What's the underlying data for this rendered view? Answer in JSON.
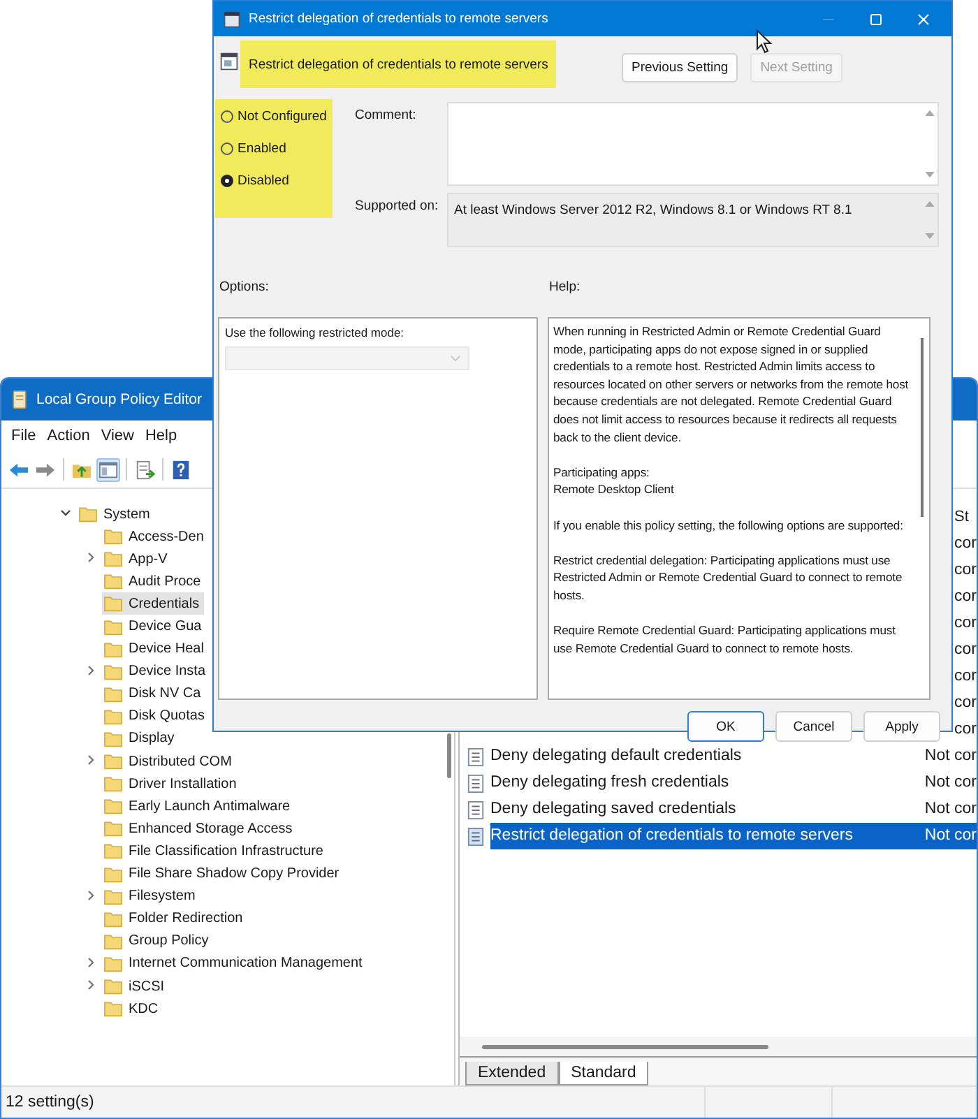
{
  "main_window": {
    "title": "Local Group Policy Editor",
    "menu": [
      "File",
      "Action",
      "View",
      "Help"
    ],
    "tree": [
      {
        "label": "System",
        "expanded": true,
        "selected": false,
        "children": [
          {
            "label": "Access-Den",
            "selected": false
          },
          {
            "label": "App-V",
            "expanded": false,
            "selected": false
          },
          {
            "label": "Audit Proce",
            "selected": false
          },
          {
            "label": "Credentials",
            "selected": true
          },
          {
            "label": "Device Gua",
            "selected": false
          },
          {
            "label": "Device Heal",
            "selected": false
          },
          {
            "label": "Device Insta",
            "expanded": false,
            "selected": false
          },
          {
            "label": "Disk NV Ca",
            "selected": false
          },
          {
            "label": "Disk Quotas",
            "selected": false
          },
          {
            "label": "Display",
            "selected": false
          },
          {
            "label": "Distributed COM",
            "expanded": false,
            "selected": false
          },
          {
            "label": "Driver Installation",
            "selected": false
          },
          {
            "label": "Early Launch Antimalware",
            "selected": false
          },
          {
            "label": "Enhanced Storage Access",
            "selected": false
          },
          {
            "label": "File Classification Infrastructure",
            "selected": false
          },
          {
            "label": "File Share Shadow Copy Provider",
            "selected": false
          },
          {
            "label": "Filesystem",
            "expanded": false,
            "selected": false
          },
          {
            "label": "Folder Redirection",
            "selected": false
          },
          {
            "label": "Group Policy",
            "selected": false
          },
          {
            "label": "Internet Communication Management",
            "expanded": false,
            "selected": false
          },
          {
            "label": "iSCSI",
            "expanded": false,
            "selected": false
          },
          {
            "label": "KDC",
            "selected": false
          }
        ]
      }
    ],
    "list": {
      "status_heading": "St",
      "rows": [
        {
          "status": "cor",
          "selected": false
        },
        {
          "status": "cor",
          "selected": false
        },
        {
          "status": "cor",
          "selected": false
        },
        {
          "status": "cor",
          "selected": false
        },
        {
          "status": "cor",
          "selected": false
        },
        {
          "status": "cor",
          "selected": false
        },
        {
          "status": "cor",
          "selected": false
        },
        {
          "status": "cor",
          "selected": false
        },
        {
          "name": "Deny delegating default credentials",
          "status": "Not cor",
          "selected": false
        },
        {
          "name": "Deny delegating fresh credentials",
          "status": "Not cor",
          "selected": false
        },
        {
          "name": "Deny delegating saved credentials",
          "status": "Not cor",
          "selected": false
        },
        {
          "name": "Restrict delegation of credentials to remote servers",
          "status": "Not cor",
          "selected": true
        }
      ]
    },
    "view_tabs": [
      {
        "label": "Extended",
        "selected": false
      },
      {
        "label": "Standard",
        "selected": true
      }
    ],
    "status_bar": "12 setting(s)"
  },
  "dialog": {
    "title": "Restrict delegation of credentials to remote servers",
    "policy_title": "Restrict delegation of credentials to remote servers",
    "policy_title_highlighted": true,
    "nav_buttons": [
      {
        "label": "Previous Setting",
        "disabled": false
      },
      {
        "label": "Next Setting",
        "disabled": true
      }
    ],
    "state_options": {
      "highlighted": true,
      "items": [
        {
          "label": "Not Configured",
          "selected": false
        },
        {
          "label": "Enabled",
          "selected": false
        },
        {
          "label": "Disabled",
          "selected": true
        }
      ]
    },
    "comment_label": "Comment:",
    "supported_label": "Supported on:",
    "supported_text": "At least Windows Server 2012 R2, Windows 8.1 or Windows RT 8.1",
    "options_label": "Options:",
    "help_label": "Help:",
    "options": {
      "label": "Use the following restricted mode:",
      "dropdown": {
        "disabled": true
      }
    },
    "help_paragraphs": [
      "When running in Restricted Admin or Remote Credential Guard mode, participating apps do not expose signed in or supplied credentials to a remote host. Restricted Admin limits access to resources located on other servers or networks from the remote host because credentials are not delegated. Remote Credential Guard does not limit access to resources because it redirects all requests back to the client device.",
      "Participating apps:\nRemote Desktop Client",
      "If you enable this policy setting, the following options are supported:",
      "Restrict credential delegation: Participating applications must use Restricted Admin or Remote Credential Guard to connect to remote hosts.",
      "Require Remote Credential Guard: Participating applications must use Remote Credential Guard to connect to remote hosts."
    ],
    "buttons": [
      {
        "label": "OK",
        "default": true
      },
      {
        "label": "Cancel",
        "default": false
      },
      {
        "label": "Apply",
        "default": false
      }
    ]
  }
}
